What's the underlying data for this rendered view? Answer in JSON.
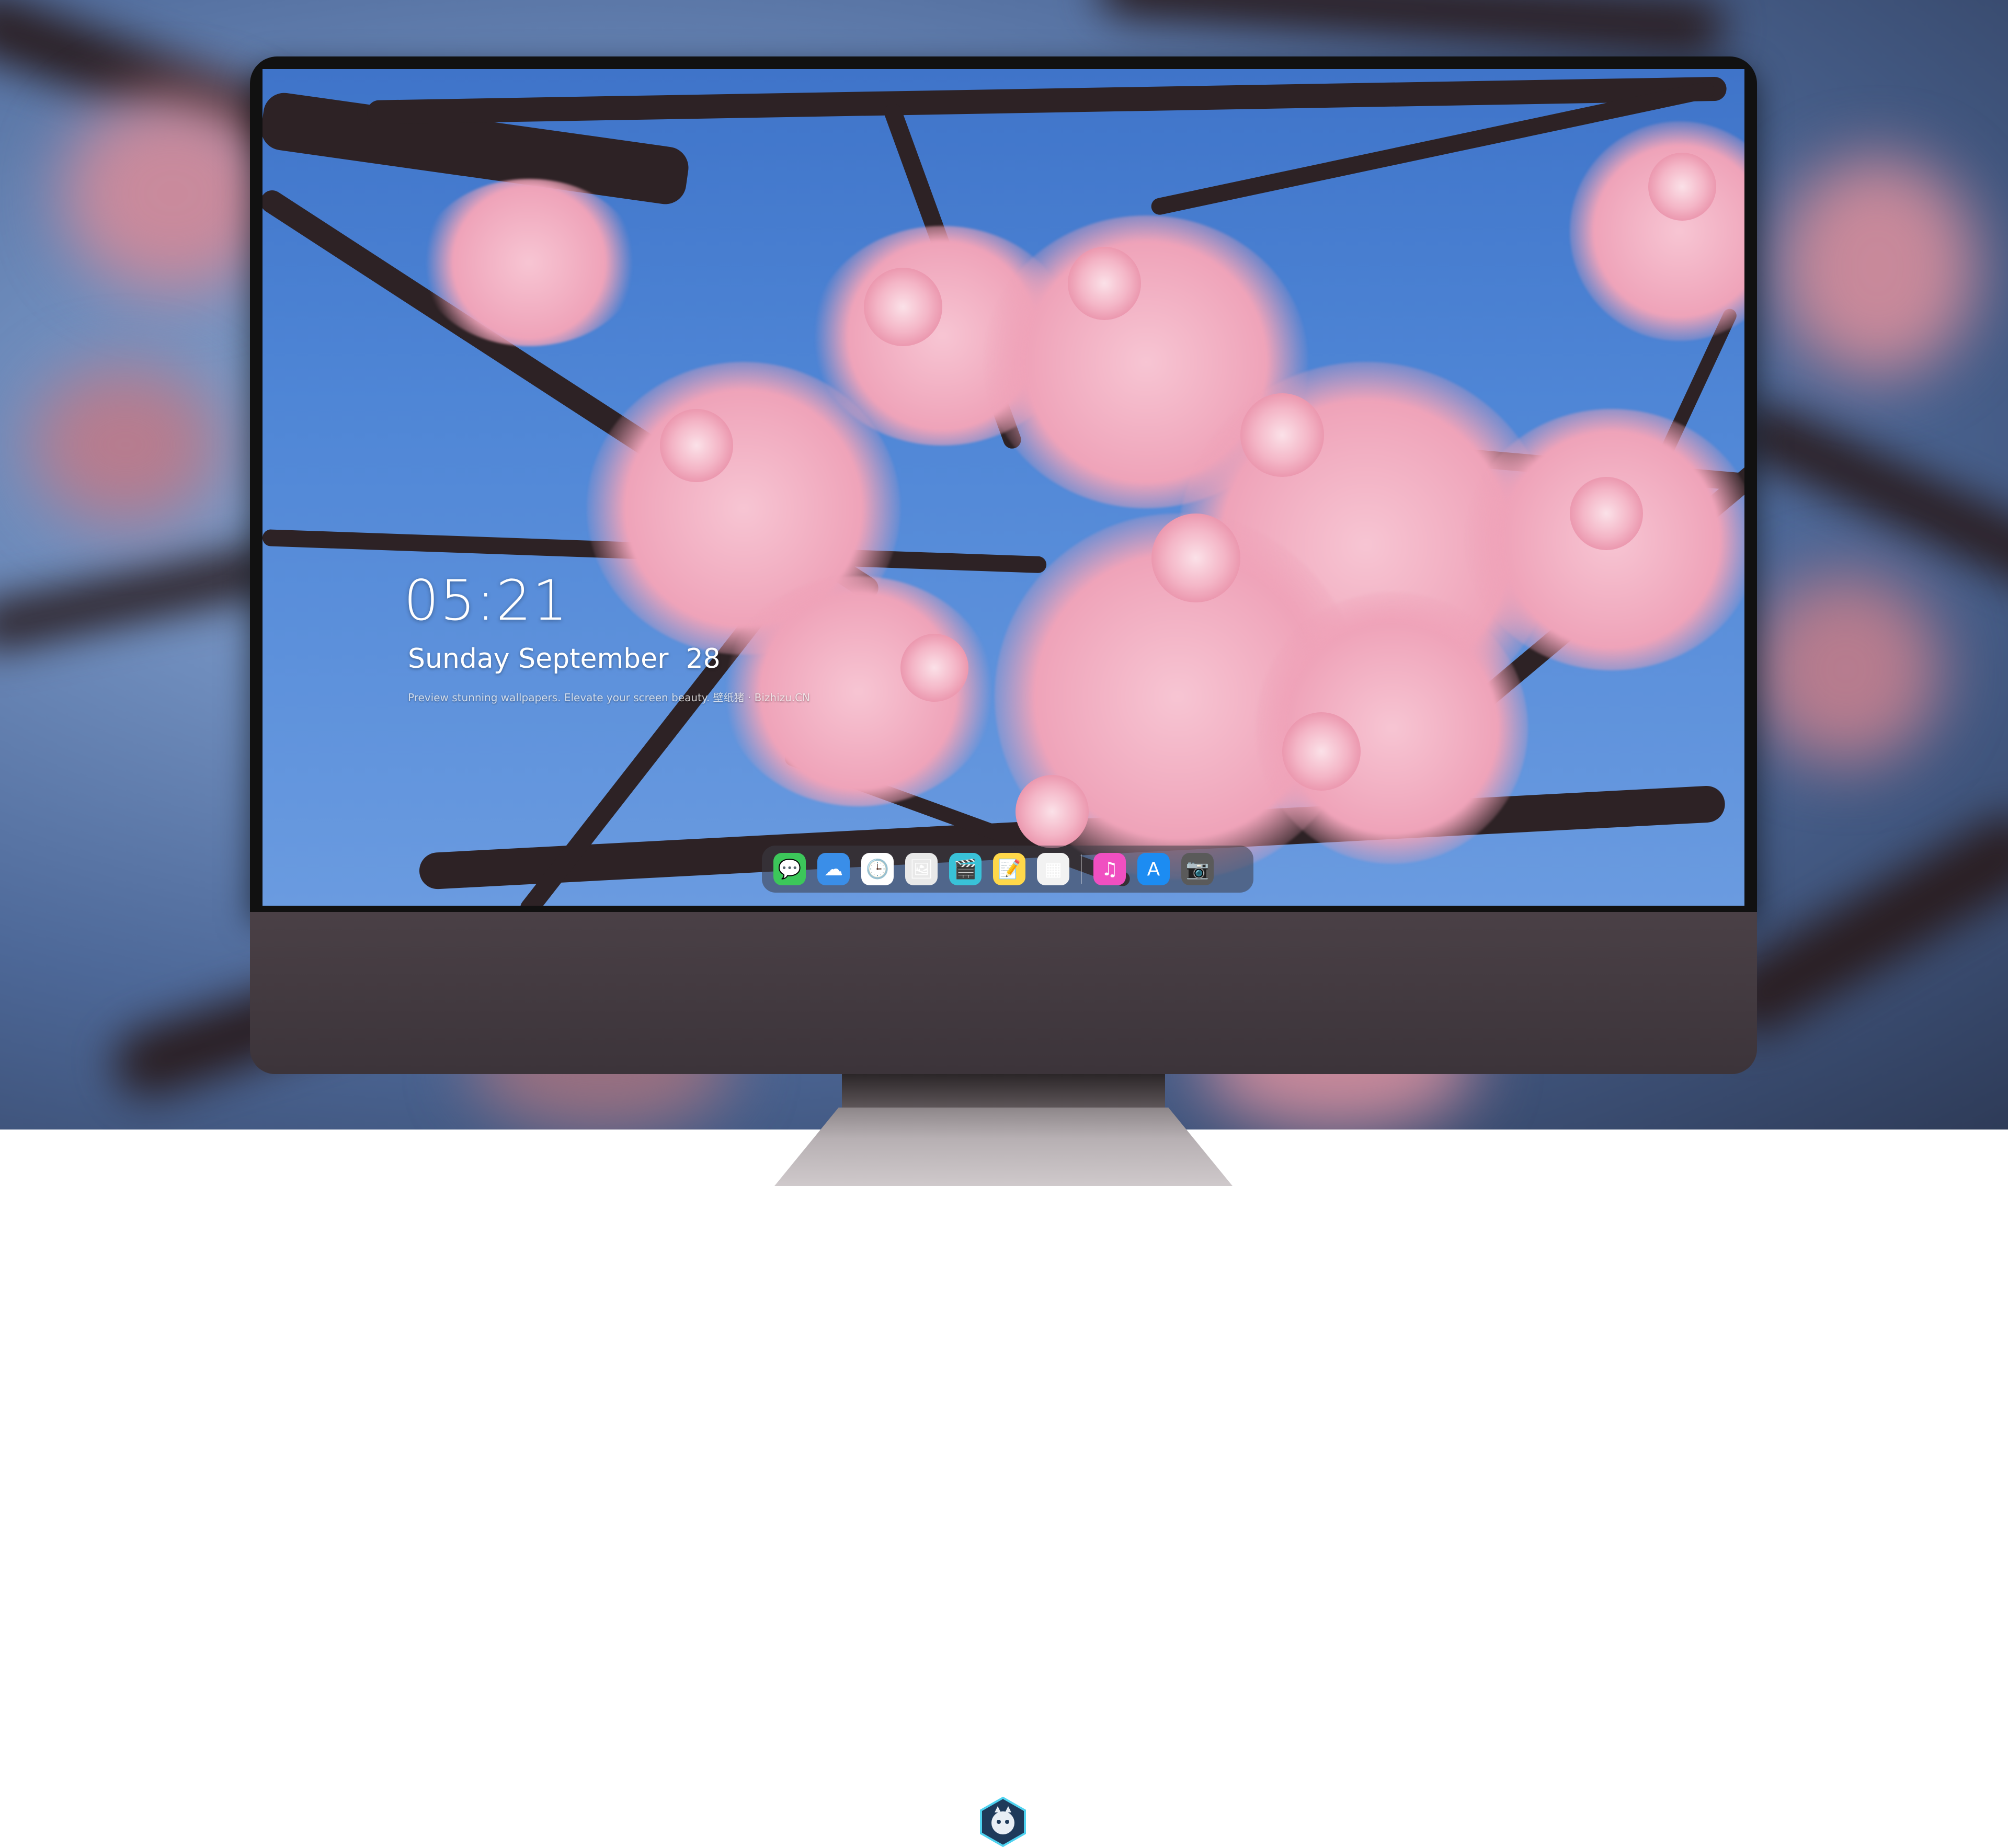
{
  "lockscreen": {
    "time": "05:21",
    "date": "Sunday September  28",
    "tagline": "Preview stunning wallpapers. Elevate your screen beauty. 壁纸猪 · Bizhizu.CN"
  },
  "dock": {
    "apps": [
      {
        "name": "messages-icon",
        "glyph": "💬",
        "bg": "#3cc75a"
      },
      {
        "name": "weather-icon",
        "glyph": "☁",
        "bg": "#3a8ee8"
      },
      {
        "name": "clock-icon",
        "glyph": "🕒",
        "bg": "#ffffff"
      },
      {
        "name": "preview-icon",
        "glyph": "🖼",
        "bg": "#e9e9e9"
      },
      {
        "name": "clips-icon",
        "glyph": "🎬",
        "bg": "#39c2d8"
      },
      {
        "name": "notes-icon",
        "glyph": "📝",
        "bg": "#ffd84a"
      },
      {
        "name": "photos-grid-icon",
        "glyph": "▦",
        "bg": "#f2f2f2"
      },
      {
        "name": "music-icon",
        "glyph": "♫",
        "bg": "#f04fc1"
      },
      {
        "name": "app-store-icon",
        "glyph": "A",
        "bg": "#1c8cf2"
      },
      {
        "name": "camera-icon",
        "glyph": "📷",
        "bg": "#5a5a5a"
      }
    ]
  },
  "colors": {
    "sky": "#4f86d6",
    "blossom": "#f4b6c7",
    "branch": "#2d2225",
    "monitor_chin": "#4a4046"
  }
}
